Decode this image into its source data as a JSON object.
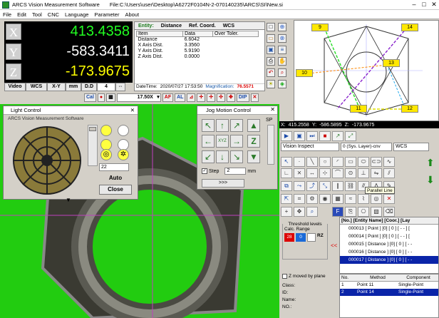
{
  "window": {
    "app_title": "ARCS Vision Measurement Software",
    "file_path": "File:C:\\Users\\user\\Desktop\\A6272F0104N-2-070140235\\ARCS\\SI\\New.si"
  },
  "menu": [
    "File",
    "Edit",
    "Tool",
    "CNC",
    "Language",
    "Parameter",
    "About"
  ],
  "dro": {
    "x": {
      "label": "X",
      "value": "413.4358",
      "color": "#22ff22"
    },
    "y": {
      "label": "Y",
      "value": "-583.3411",
      "color": "#ffffff"
    },
    "z": {
      "label": "Z",
      "value": "-173.9675",
      "color": "#ffff00"
    }
  },
  "dro_buttons": [
    "Video",
    "WCS",
    "X-Y",
    "mm",
    "D.D",
    "4"
  ],
  "entity_panel": {
    "tabs": [
      "Entity:",
      "Distance",
      "Ref. Coord.",
      "WCS"
    ],
    "columns": [
      "Item",
      "Data",
      "Over Toler."
    ],
    "rows": [
      {
        "item": "Distance",
        "data": "6.6042"
      },
      {
        "item": "X Axis Dist.",
        "data": "3.3560"
      },
      {
        "item": "Y Axis Dist.",
        "data": "5.9190"
      },
      {
        "item": "Z Axis Dist.",
        "data": "0.0000"
      }
    ],
    "datetime_label": "DateTime:",
    "datetime": "2020/07/27 17:53:50",
    "magnification_label": "Magnification:",
    "magnification": "76.5571"
  },
  "zoom": {
    "cal": "Cal",
    "value": "17.50X",
    "af": "AF",
    "al": "AL",
    "dip": "DIP"
  },
  "navigator": {
    "points": [
      "9",
      "14",
      "10",
      "13",
      "11",
      "12"
    ]
  },
  "light_control": {
    "title": "Light Control",
    "value": "22",
    "auto": "Auto",
    "close": "Close"
  },
  "jog": {
    "title": "Jog Motion Control",
    "speed_label": "SP",
    "center": "XYZ",
    "z_up": "Z",
    "z_down": "Z",
    "step_label": "Step",
    "step_value": "2",
    "unit": "mm",
    "go": ">>>"
  },
  "coords_bar": {
    "x_label": "X:",
    "x": "415.2558",
    "y_label": "Y:",
    "y": "-586.5895",
    "z_label": "Z:",
    "z": "-173.9675"
  },
  "right_panel": {
    "mode": "Vision Inspect",
    "layer": "0 (Sys. Layer)-cnv",
    "wcs": "WCS",
    "tooltip": "Parallel Line",
    "threshold_title": "Threshold levels",
    "threshold_sub": "Calc. Range",
    "threshold_vals": [
      "28",
      "0"
    ],
    "threshold_rz": "RZ",
    "list_header": "[No.] [Entity Name] [Coor.] [Lay",
    "list_items": [
      "000013 [ Point ] [0] [ 0 ] [ - - ] [",
      "000014 [ Point ] [0] [ 0 ] [ - - ] [",
      "000015 [ Distance ] [0] [ 0 ] [ - -",
      "000016 [ Distance ] [0] [ 0 ] [ - -",
      "000017 [ Distance ] [0] [ 0 ] [ - -"
    ],
    "z_moved": "Z moved by plane",
    "method_cols": [
      "No.",
      "Method",
      "Component"
    ],
    "method_rows": [
      {
        "no": "1",
        "method": "Point 11",
        "component": "Single-Point"
      },
      {
        "no": "2",
        "method": "Point 14",
        "component": "Single-Point"
      }
    ],
    "fields": [
      "Class:",
      "ID:",
      "Name:",
      "NO.:"
    ]
  }
}
